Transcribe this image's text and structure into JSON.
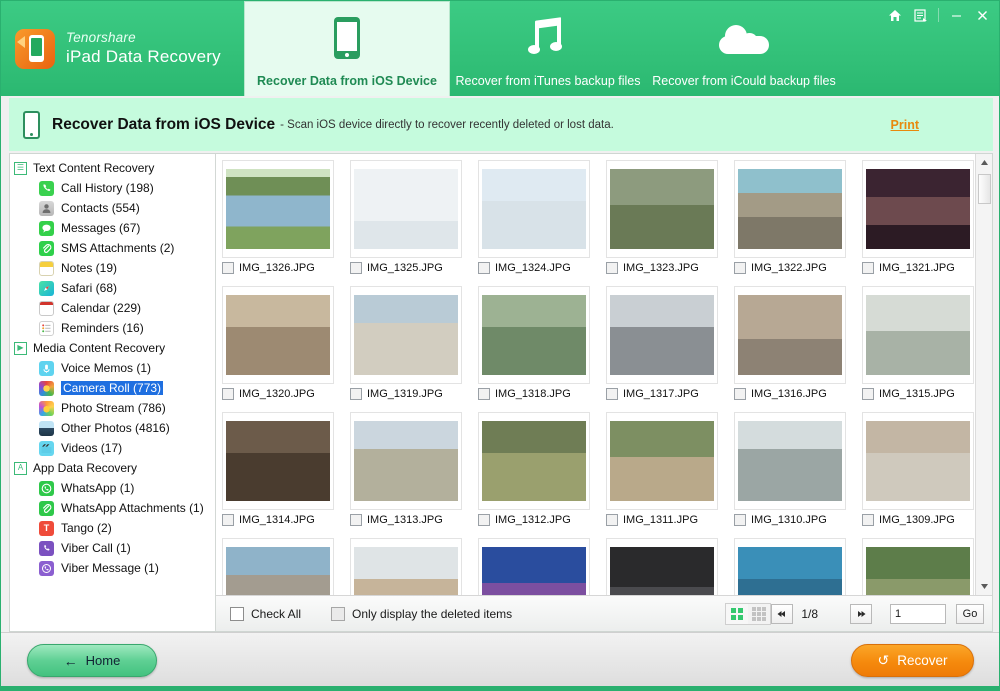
{
  "window": {
    "brand_top": "Tenorshare",
    "brand_bottom": "iPad Data Recovery",
    "controls": [
      {
        "name": "home-icon",
        "glyph": "⌂"
      },
      {
        "name": "register-icon",
        "glyph": "὜A"
      },
      {
        "name": "minimize-button",
        "glyph": "–"
      },
      {
        "name": "close-button",
        "glyph": "✕"
      }
    ]
  },
  "tabs": [
    {
      "label": "Recover Data from iOS Device",
      "icon": "device-icon",
      "active": true
    },
    {
      "label": "Recover from iTunes backup files",
      "icon": "music-note-icon",
      "active": false
    },
    {
      "label": "Recover from iCould backup files",
      "icon": "cloud-icon",
      "active": false
    }
  ],
  "sub_header": {
    "icon": "device-icon",
    "title": "Recover Data from iOS Device",
    "description": "- Scan iOS device directly to recover recently deleted or lost data.",
    "print_label": "Print"
  },
  "sidebar": {
    "groups": [
      {
        "label": "Text Content Recovery",
        "expander": "☰",
        "items": [
          {
            "label": "Call History (198)",
            "icon": "call-history-icon",
            "icon_class": "ic-call",
            "glyph": "✆",
            "selected": false
          },
          {
            "label": "Contacts (554)",
            "icon": "contacts-icon",
            "icon_class": "ic-contacts",
            "glyph": "☺",
            "selected": false
          },
          {
            "label": "Messages (67)",
            "icon": "messages-icon",
            "icon_class": "ic-msg",
            "glyph": "●",
            "selected": false
          },
          {
            "label": "SMS Attachments (2)",
            "icon": "sms-attachments-icon",
            "icon_class": "ic-sms",
            "glyph": "ὌE",
            "selected": false
          },
          {
            "label": "Notes (19)",
            "icon": "notes-icon",
            "icon_class": "ic-notes",
            "glyph": "",
            "selected": false
          },
          {
            "label": "Safari (68)",
            "icon": "safari-icon",
            "icon_class": "ic-safari",
            "glyph": "✦",
            "selected": false
          },
          {
            "label": "Calendar (229)",
            "icon": "calendar-icon",
            "icon_class": "ic-cal",
            "glyph": "9",
            "selected": false
          },
          {
            "label": "Reminders (16)",
            "icon": "reminders-icon",
            "icon_class": "ic-rem",
            "glyph": "",
            "selected": false
          }
        ]
      },
      {
        "label": "Media Content Recovery",
        "expander": "▶",
        "items": [
          {
            "label": "Voice Memos (1)",
            "icon": "voice-memos-icon",
            "icon_class": "ic-voice",
            "glyph": "Ἲ4",
            "selected": false
          },
          {
            "label": "Camera Roll (773)",
            "icon": "camera-roll-icon",
            "icon_class": "ic-camroll",
            "glyph": "",
            "selected": true
          },
          {
            "label": "Photo Stream (786)",
            "icon": "photo-stream-icon",
            "icon_class": "ic-photos",
            "glyph": "",
            "selected": false
          },
          {
            "label": "Other Photos (4816)",
            "icon": "other-photos-icon",
            "icon_class": "ic-other",
            "glyph": "",
            "selected": false
          },
          {
            "label": "Videos (17)",
            "icon": "videos-icon",
            "icon_class": "ic-video",
            "glyph": "»",
            "selected": false
          }
        ]
      },
      {
        "label": "App Data Recovery",
        "expander": "A",
        "items": [
          {
            "label": "WhatsApp (1)",
            "icon": "whatsapp-icon",
            "icon_class": "ic-wa",
            "glyph": "✆",
            "selected": false
          },
          {
            "label": "WhatsApp Attachments (1)",
            "icon": "whatsapp-attachments-icon",
            "icon_class": "ic-waatt",
            "glyph": "ὌE",
            "selected": false
          },
          {
            "label": "Tango (2)",
            "icon": "tango-icon",
            "icon_class": "ic-tango",
            "glyph": "T",
            "selected": false
          },
          {
            "label": "Viber Call (1)",
            "icon": "viber-call-icon",
            "icon_class": "ic-viber",
            "glyph": "✆",
            "selected": false
          },
          {
            "label": "Viber Message (1)",
            "icon": "viber-message-icon",
            "icon_class": "ic-vibm",
            "glyph": "✆",
            "selected": false
          }
        ]
      }
    ]
  },
  "thumbnails": [
    {
      "filename": "IMG_1326.JPG",
      "checked": false,
      "scene": "kids-jumping-lake"
    },
    {
      "filename": "IMG_1325.JPG",
      "checked": false,
      "scene": "girl-violin-room"
    },
    {
      "filename": "IMG_1324.JPG",
      "checked": false,
      "scene": "kids-tablet-classroom"
    },
    {
      "filename": "IMG_1323.JPG",
      "checked": false,
      "scene": "woman-walking-field"
    },
    {
      "filename": "IMG_1322.JPG",
      "checked": false,
      "scene": "woman-red-dress-bridge"
    },
    {
      "filename": "IMG_1321.JPG",
      "checked": false,
      "scene": "woman-table-dim-light"
    },
    {
      "filename": "IMG_1320.JPG",
      "checked": false,
      "scene": "woman-floral-dress-beach"
    },
    {
      "filename": "IMG_1319.JPG",
      "checked": false,
      "scene": "woman-with-horse-beach"
    },
    {
      "filename": "IMG_1318.JPG",
      "checked": false,
      "scene": "woman-tracksuit-hillside"
    },
    {
      "filename": "IMG_1317.JPG",
      "checked": false,
      "scene": "group-people-street"
    },
    {
      "filename": "IMG_1316.JPG",
      "checked": false,
      "scene": "people-old-building"
    },
    {
      "filename": "IMG_1315.JPG",
      "checked": false,
      "scene": "friends-walking-group"
    },
    {
      "filename": "IMG_1314.JPG",
      "checked": false,
      "scene": "woman-reading-outdoors"
    },
    {
      "filename": "IMG_1313.JPG",
      "checked": false,
      "scene": "couple-kissing-columns"
    },
    {
      "filename": "IMG_1312.JPG",
      "checked": false,
      "scene": "woman-cotton-candy"
    },
    {
      "filename": "IMG_1311.JPG",
      "checked": false,
      "scene": "woman-white-dress-path"
    },
    {
      "filename": "IMG_1310.JPG",
      "checked": false,
      "scene": "person-laptop-shore"
    },
    {
      "filename": "IMG_1309.JPG",
      "checked": false,
      "scene": "girl-sitting-pavement"
    },
    {
      "filename": "",
      "checked": false,
      "scene": "street-buildings-couple"
    },
    {
      "filename": "",
      "checked": false,
      "scene": "family-with-dog"
    },
    {
      "filename": "",
      "checked": false,
      "scene": "girl-purple-shirt"
    },
    {
      "filename": "",
      "checked": false,
      "scene": "dark-car-scene"
    },
    {
      "filename": "",
      "checked": false,
      "scene": "child-smiling-blue"
    },
    {
      "filename": "",
      "checked": false,
      "scene": "woman-running-path"
    }
  ],
  "panel_bar": {
    "check_all_label": "Check All",
    "check_all_checked": false,
    "only_deleted_label": "Only display the deleted items",
    "only_deleted_checked": false,
    "view_grid_large": "grid-large-icon",
    "view_grid_small": "grid-small-icon",
    "prev_glyph": "◀◀",
    "next_glyph": "▶▶",
    "page_indicator": "1/8",
    "page_input_value": "1",
    "go_label": "Go"
  },
  "footer": {
    "home_label": "Home",
    "home_arrow": "←",
    "recover_label": "Recover",
    "recover_arrow": "↺"
  },
  "colors": {
    "header_green": "#33c179",
    "sub_header_green": "#c5fbdd",
    "selection_blue": "#1f6fe0",
    "print_orange": "#e8890c",
    "recover_orange": "#f58a0d",
    "accent_green": "#2ab06f"
  }
}
